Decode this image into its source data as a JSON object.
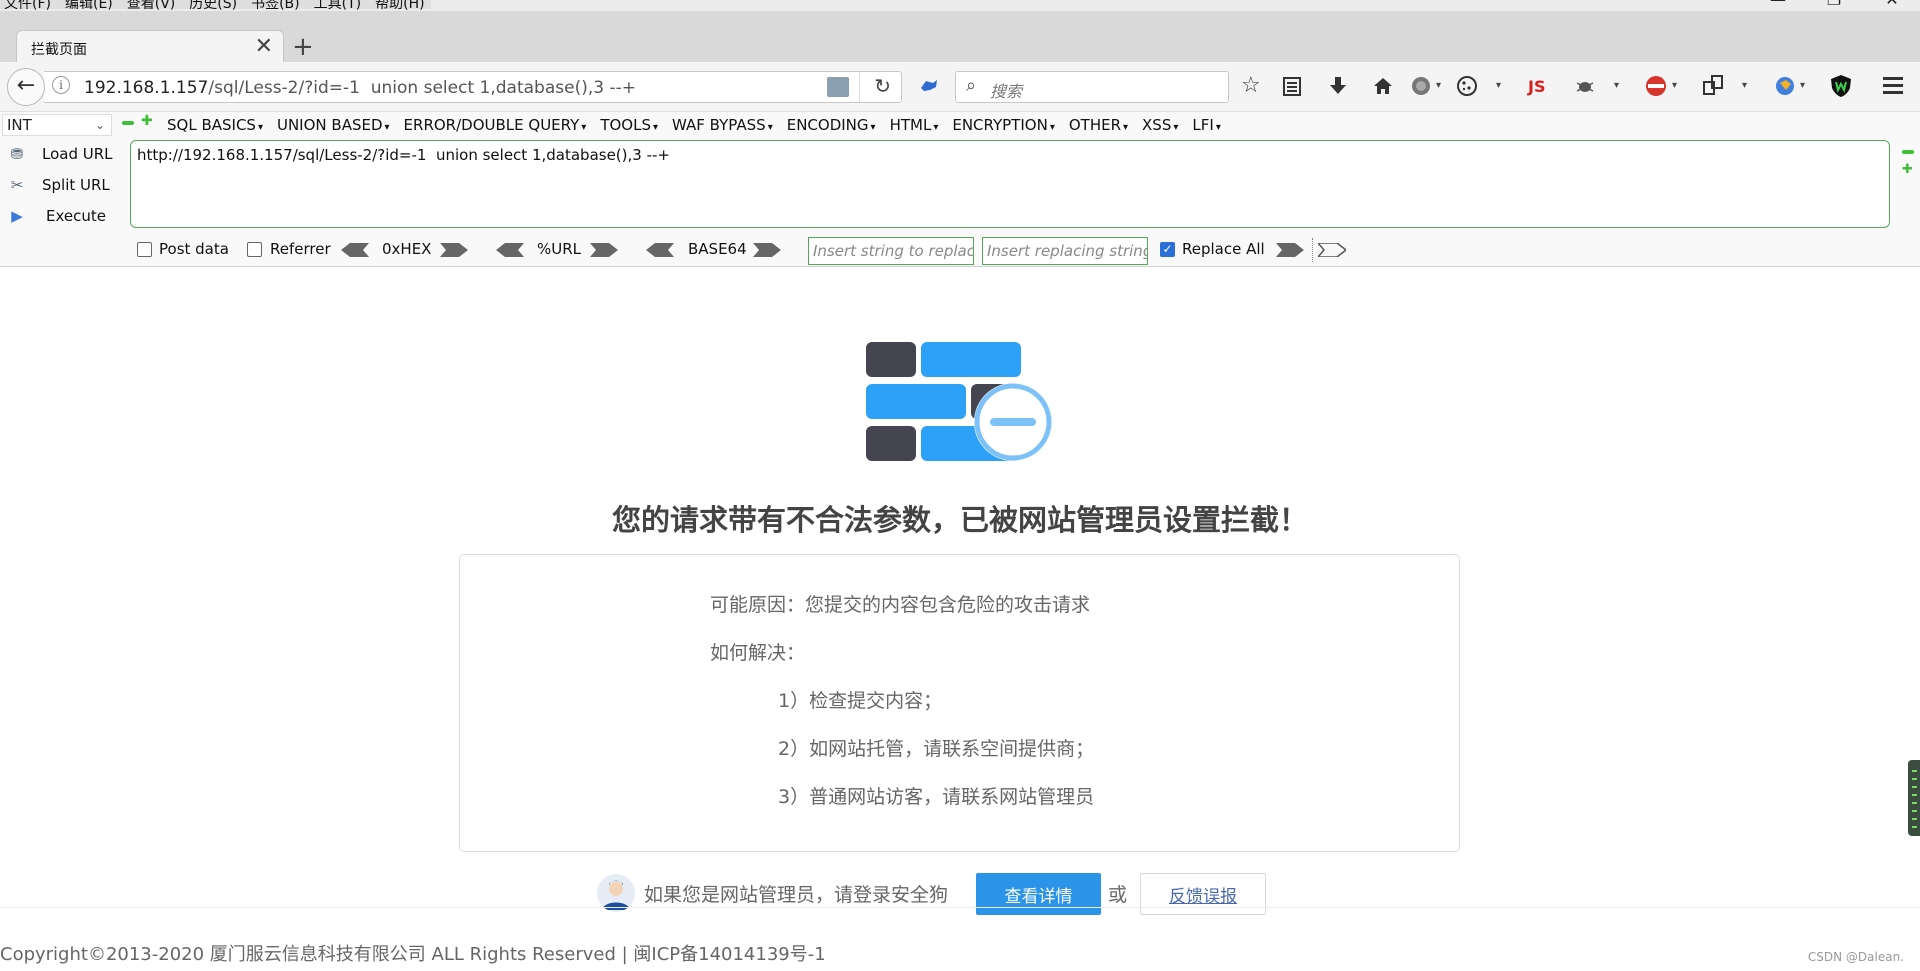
{
  "menubar": {
    "items": [
      "文件(F)",
      "编辑(E)",
      "查看(V)",
      "历史(S)",
      "书签(B)",
      "工具(T)",
      "帮助(H)"
    ],
    "minimize": "—",
    "restore": "❐",
    "close": "✕"
  },
  "tab": {
    "title": "拦截页面",
    "close_glyph": "✕",
    "new_tab_glyph": "+"
  },
  "navbar": {
    "back_glyph": "←",
    "info_glyph": "i",
    "url_host": "192.168.1.157",
    "url_rest": "/sql/Less-2/?id=-1  union select 1,database(),3 --+",
    "reload_glyph": "↻",
    "search_placeholder": "搜索",
    "search_glyph": "⌕",
    "js_label": "JS",
    "icons": [
      "puzzle-icon",
      "star-icon",
      "reader-icon",
      "download-icon",
      "home-icon",
      "globe-icon",
      "cookie-icon",
      "bug-icon",
      "shield-icon"
    ]
  },
  "hackbar": {
    "int_select": "INT",
    "menus": [
      "SQL BASICS",
      "UNION BASED",
      "ERROR/DOUBLE QUERY",
      "TOOLS",
      "WAF BYPASS",
      "ENCODING",
      "HTML",
      "ENCRYPTION",
      "OTHER",
      "XSS",
      "LFI"
    ],
    "load_url": "Load URL",
    "split_url": "Split URL",
    "execute": "Execute",
    "url_text": "http://192.168.1.157/sql/Less-2/?id=-1  union select 1,database(),3 --+",
    "post_data": "Post data",
    "referrer": "Referrer",
    "hex": "0xHEX",
    "urlenc": "%URL",
    "base64": "BASE64",
    "replace_placeholder": "Insert string to replace",
    "replacing_placeholder": "Insert replacing string",
    "replace_all": "Replace All",
    "post_data_checked": false,
    "referrer_checked": false,
    "replace_all_checked": true
  },
  "page": {
    "heading": "您的请求带有不合法参数，已被网站管理员设置拦截！",
    "reason": "可能原因：您提交的内容包含危险的攻击请求",
    "how": "如何解决：",
    "step1": "1）检查提交内容；",
    "step2": "2）如网站托管，请联系空间提供商；",
    "step3": "3）普通网站访客，请联系网站管理员",
    "admin_text": "如果您是网站管理员，请登录安全狗",
    "detail_button": "查看详情",
    "or_text": "或",
    "feedback_button": "反馈误报",
    "copyright": "Copyright©2013-2020 厦门服云信息科技有限公司 ALL Rights Reserved | 闽ICP备14014139号-1",
    "watermark": "CSDN @Dalean."
  },
  "colors": {
    "accent_blue": "#2b94e8",
    "brick_dark": "#454552",
    "brick_blue": "#2da1f8",
    "hackbar_border": "#57a75a"
  }
}
